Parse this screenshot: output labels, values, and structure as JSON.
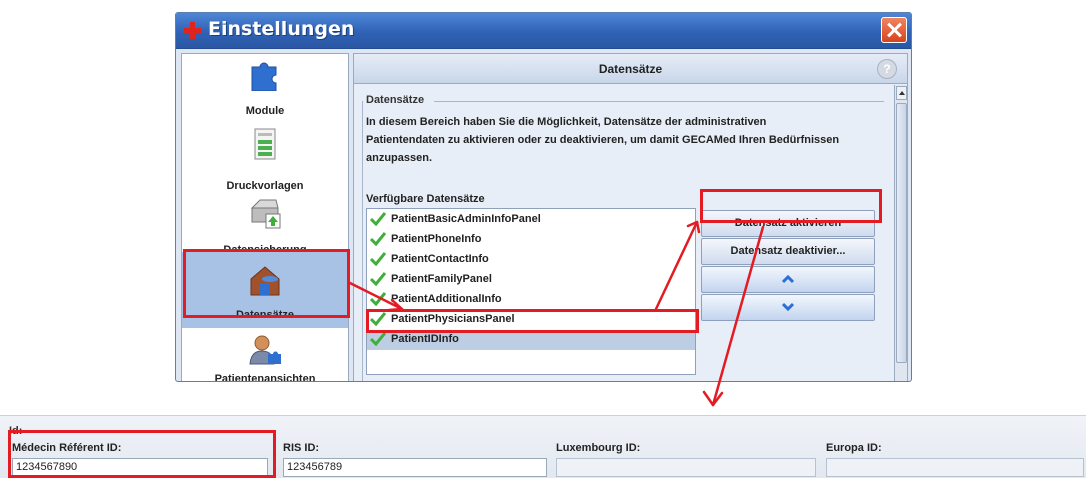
{
  "window": {
    "title": "Einstellungen"
  },
  "sidebar": {
    "items": [
      {
        "label": "Module",
        "icon": "puzzle-icon"
      },
      {
        "label": "Druckvorlagen",
        "icon": "document-icon"
      },
      {
        "label": "Datensicherung",
        "icon": "backup-drive-icon"
      },
      {
        "label": "Datensätze",
        "icon": "house-database-icon",
        "selected": true
      },
      {
        "label": "Patientenansichten",
        "icon": "user-puzzle-icon"
      }
    ]
  },
  "main": {
    "title": "Datensätze",
    "help_label": "?",
    "group_title": "Datensätze",
    "description": "In diesem Bereich haben Sie die Möglichkeit, Datensätze der administrativen Patientendaten zu aktivieren oder zu deaktivieren, um damit GECAMed Ihren Bedürfnissen anzupassen.",
    "list_label": "Verfügbare Datensätze",
    "records": [
      {
        "label": "PatientBasicAdminInfoPanel",
        "checked": true
      },
      {
        "label": "PatientPhoneInfo",
        "checked": true
      },
      {
        "label": "PatientContactInfo",
        "checked": true
      },
      {
        "label": "PatientFamilyPanel",
        "checked": true
      },
      {
        "label": "PatientAdditionalInfo",
        "checked": true
      },
      {
        "label": "PatientPhysiciansPanel",
        "checked": true
      },
      {
        "label": "PatientIDInfo",
        "checked": true,
        "selected": true
      }
    ],
    "buttons": {
      "activate": "Datensatz aktivieren",
      "deactivate": "Datensatz deaktivier..."
    }
  },
  "id_section": {
    "header": "Id:",
    "fields": [
      {
        "label": "Médecin Référent ID:",
        "value": "1234567890",
        "enabled": true
      },
      {
        "label": "RIS ID:",
        "value": "123456789",
        "enabled": true
      },
      {
        "label": "Luxembourg ID:",
        "value": "",
        "enabled": false
      },
      {
        "label": "Europa ID:",
        "value": "",
        "enabled": false
      }
    ]
  },
  "colors": {
    "title_bar": "#2f62b5",
    "selection": "#a8c2e6",
    "annotation_red": "#e31b23",
    "check_green": "#3fae3a",
    "arrow_blue": "#2a6fd6"
  }
}
